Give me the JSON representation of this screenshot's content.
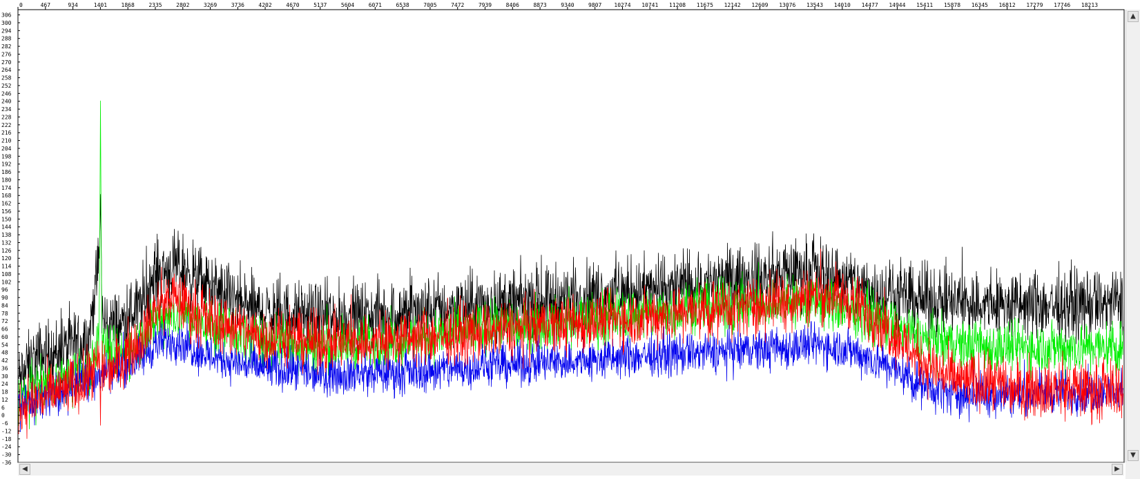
{
  "chart_data": {
    "type": "line",
    "title": "",
    "xlabel": "",
    "ylabel": "",
    "grid": false,
    "xlim": [
      0,
      18800
    ],
    "ylim": [
      -36,
      310
    ],
    "x_ticks": [
      0,
      467,
      934,
      1401,
      1868,
      2335,
      2802,
      3269,
      3736,
      4202,
      4670,
      5137,
      5604,
      6071,
      6538,
      7005,
      7472,
      7939,
      8406,
      8873,
      9340,
      9807,
      10274,
      10741,
      11208,
      11675,
      12142,
      12609,
      13076,
      13543,
      14010,
      14477,
      14944,
      15411,
      15878,
      16345,
      16812,
      17279,
      17746,
      18213
    ],
    "y_ticks": [
      306,
      300,
      294,
      288,
      282,
      276,
      270,
      264,
      258,
      252,
      246,
      240,
      234,
      228,
      222,
      216,
      210,
      204,
      198,
      192,
      186,
      180,
      174,
      168,
      162,
      156,
      150,
      144,
      138,
      132,
      126,
      120,
      114,
      108,
      102,
      96,
      90,
      84,
      78,
      72,
      66,
      60,
      54,
      48,
      42,
      36,
      30,
      24,
      18,
      12,
      6,
      0,
      -6,
      -12,
      -18,
      -24,
      -30,
      -36
    ],
    "series": [
      {
        "color": "#000000",
        "spread": 26,
        "x": [
          0,
          300,
          800,
          1200,
          1380,
          1401,
          1430,
          1700,
          2100,
          2335,
          2600,
          2802,
          3100,
          3500,
          3736,
          4202,
          5137,
          6071,
          7005,
          7939,
          8873,
          9807,
          10741,
          11675,
          12609,
          13076,
          13543,
          14010,
          14477,
          14944,
          15411,
          15878,
          16812,
          17746,
          18213,
          18800
        ],
        "y": [
          26,
          44,
          50,
          58,
          120,
          165,
          72,
          68,
          85,
          108,
          112,
          112,
          102,
          92,
          86,
          78,
          74,
          76,
          80,
          84,
          88,
          92,
          95,
          100,
          104,
          108,
          110,
          104,
          96,
          90,
          88,
          86,
          84,
          84,
          85,
          86
        ]
      },
      {
        "color": "#00ee00",
        "spread": 20,
        "x": [
          0,
          300,
          800,
          1200,
          1380,
          1401,
          1430,
          1700,
          2100,
          2335,
          2600,
          2802,
          3100,
          3736,
          4202,
          5137,
          6071,
          7005,
          7939,
          8873,
          9807,
          10741,
          11675,
          12609,
          13076,
          13543,
          14010,
          14477,
          14944,
          15411,
          15878,
          16812,
          17746,
          18213,
          18800
        ],
        "y": [
          14,
          20,
          26,
          34,
          60,
          240,
          52,
          44,
          58,
          72,
          78,
          78,
          70,
          62,
          56,
          52,
          56,
          60,
          66,
          70,
          74,
          78,
          82,
          84,
          86,
          86,
          82,
          76,
          66,
          58,
          54,
          52,
          52,
          52,
          52
        ]
      },
      {
        "color": "#0000ee",
        "spread": 16,
        "x": [
          0,
          300,
          800,
          1200,
          1401,
          1700,
          2100,
          2335,
          2600,
          2802,
          3100,
          3736,
          4202,
          5137,
          6071,
          7005,
          7939,
          8873,
          9807,
          10741,
          11675,
          12609,
          13076,
          13543,
          14010,
          14477,
          14944,
          15411,
          15878,
          16812,
          17746,
          18213,
          18800
        ],
        "y": [
          6,
          12,
          20,
          28,
          32,
          36,
          44,
          54,
          58,
          56,
          48,
          40,
          36,
          32,
          32,
          34,
          38,
          40,
          42,
          46,
          48,
          50,
          52,
          54,
          52,
          44,
          34,
          22,
          16,
          16,
          18,
          18,
          18
        ]
      },
      {
        "color": "#ff0000",
        "spread": 22,
        "x": [
          0,
          300,
          800,
          1200,
          1380,
          1401,
          1430,
          1700,
          2100,
          2335,
          2600,
          2802,
          3100,
          3736,
          4202,
          5137,
          6071,
          7005,
          7939,
          8873,
          9807,
          10741,
          11675,
          12609,
          13076,
          13543,
          14010,
          14477,
          14944,
          15411,
          15878,
          16812,
          17746,
          18213,
          18800
        ],
        "y": [
          6,
          12,
          20,
          28,
          40,
          4,
          34,
          40,
          60,
          80,
          90,
          86,
          76,
          66,
          60,
          56,
          56,
          60,
          64,
          68,
          72,
          76,
          80,
          84,
          88,
          92,
          90,
          78,
          60,
          40,
          28,
          22,
          20,
          20,
          20
        ]
      }
    ]
  }
}
